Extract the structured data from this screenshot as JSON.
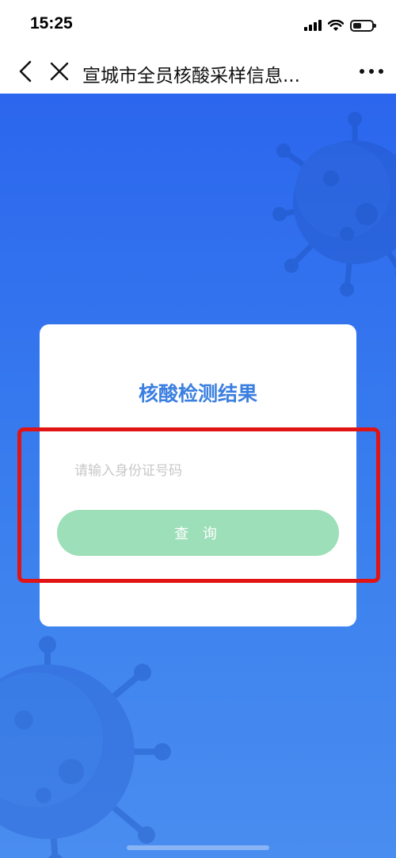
{
  "status_bar": {
    "time": "15:25"
  },
  "nav": {
    "title": "宣城市全员核酸采样信息...",
    "back_icon": "chevron-left-icon",
    "close_icon": "close-icon",
    "more_icon": "more-dots-icon"
  },
  "card": {
    "title": "核酸检测结果",
    "id_input": {
      "value": "",
      "placeholder": "请输入身份证号码"
    },
    "query_button_label": "查 询"
  },
  "colors": {
    "background": "#2f6ff0",
    "title_blue": "#3b7fe0",
    "button_green": "#9cdfb8",
    "highlight_red": "#e01414"
  }
}
